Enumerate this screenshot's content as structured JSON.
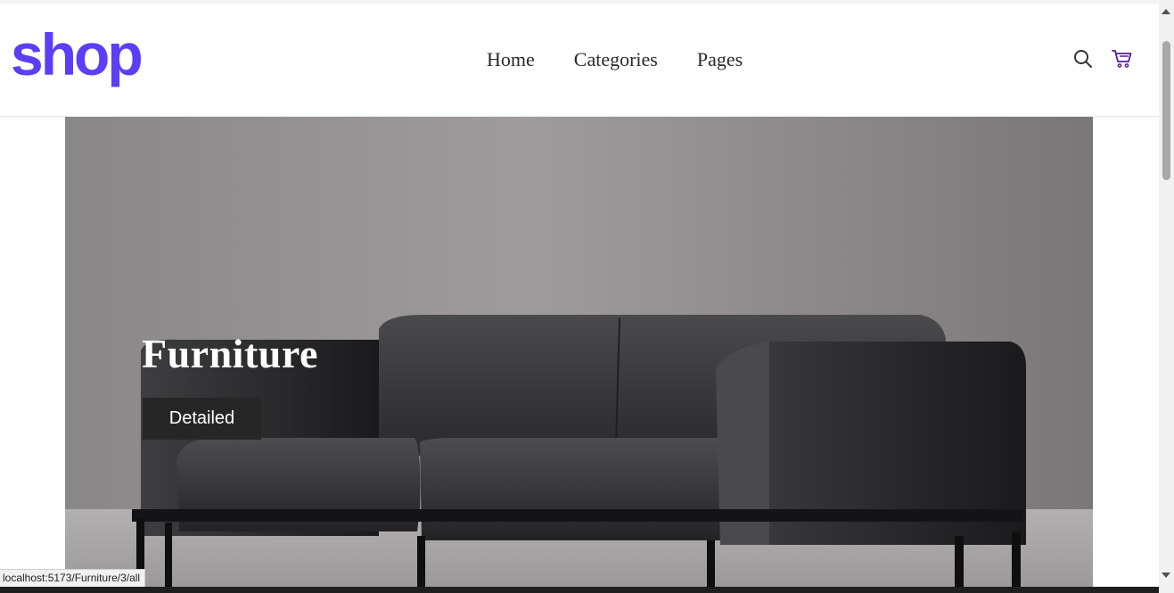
{
  "header": {
    "logo_text": "shop",
    "logo_color": "#5b3ef5",
    "nav": [
      {
        "label": "Home"
      },
      {
        "label": "Categories"
      },
      {
        "label": "Pages"
      }
    ],
    "icons": [
      "search-icon",
      "cart-icon"
    ],
    "cart_icon_color": "#5a1f8c"
  },
  "hero": {
    "title": "Furniture",
    "button_label": "Detailed",
    "image": "black leather sofa"
  },
  "status_bar": {
    "url": "localhost:5173/Furniture/3/all"
  }
}
